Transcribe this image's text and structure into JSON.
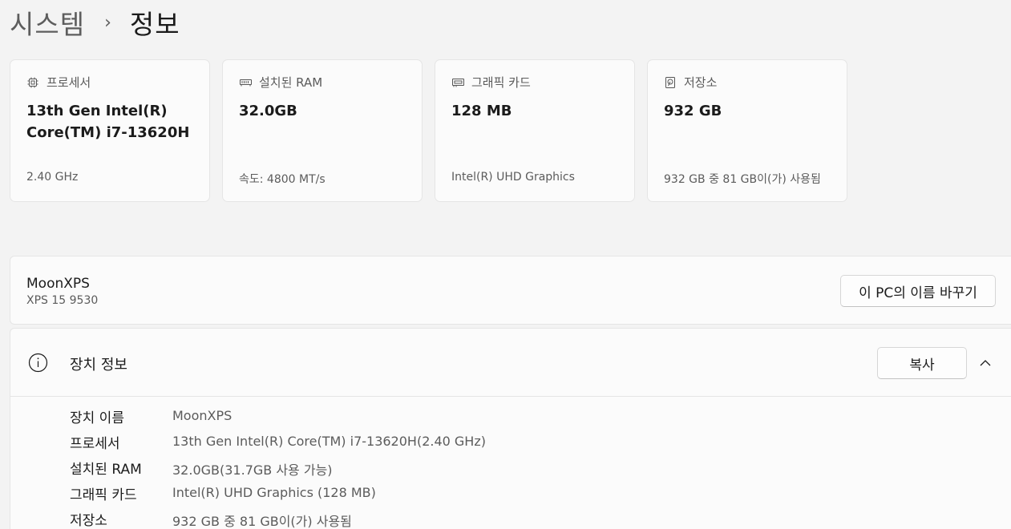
{
  "breadcrumb": {
    "parent": "시스템",
    "separator": "›",
    "current": "정보"
  },
  "specs": [
    {
      "icon": "processor-icon",
      "label": "프로세서",
      "value": "13th Gen Intel(R) Core(TM) i7-13620H",
      "detail": "2.40 GHz"
    },
    {
      "icon": "ram-icon",
      "label": "설치된 RAM",
      "value": "32.0GB",
      "detail": "속도: 4800 MT/s"
    },
    {
      "icon": "graphics-card-icon",
      "label": "그래픽 카드",
      "value": "128 MB",
      "detail": "Intel(R) UHD Graphics"
    },
    {
      "icon": "storage-icon",
      "label": "저장소",
      "value": "932 GB",
      "detail": "932 GB 중 81 GB이(가) 사용됨"
    }
  ],
  "pc": {
    "name": "MoonXPS",
    "model": "XPS 15 9530",
    "rename_label": "이 PC의 이름 바꾸기"
  },
  "device_info": {
    "icon": "info-icon",
    "title": "장치 정보",
    "copy_label": "복사",
    "rows": [
      {
        "key": "장치 이름",
        "value": "MoonXPS"
      },
      {
        "key": "프로세서",
        "value": "13th Gen Intel(R) Core(TM) i7-13620H(2.40 GHz)"
      },
      {
        "key": "설치된 RAM",
        "value": "32.0GB(31.7GB 사용 가능)"
      },
      {
        "key": "그래픽 카드",
        "value": "Intel(R) UHD Graphics (128 MB)"
      },
      {
        "key": "저장소",
        "value": "932 GB 중 81 GB이(가) 사용됨"
      }
    ]
  }
}
